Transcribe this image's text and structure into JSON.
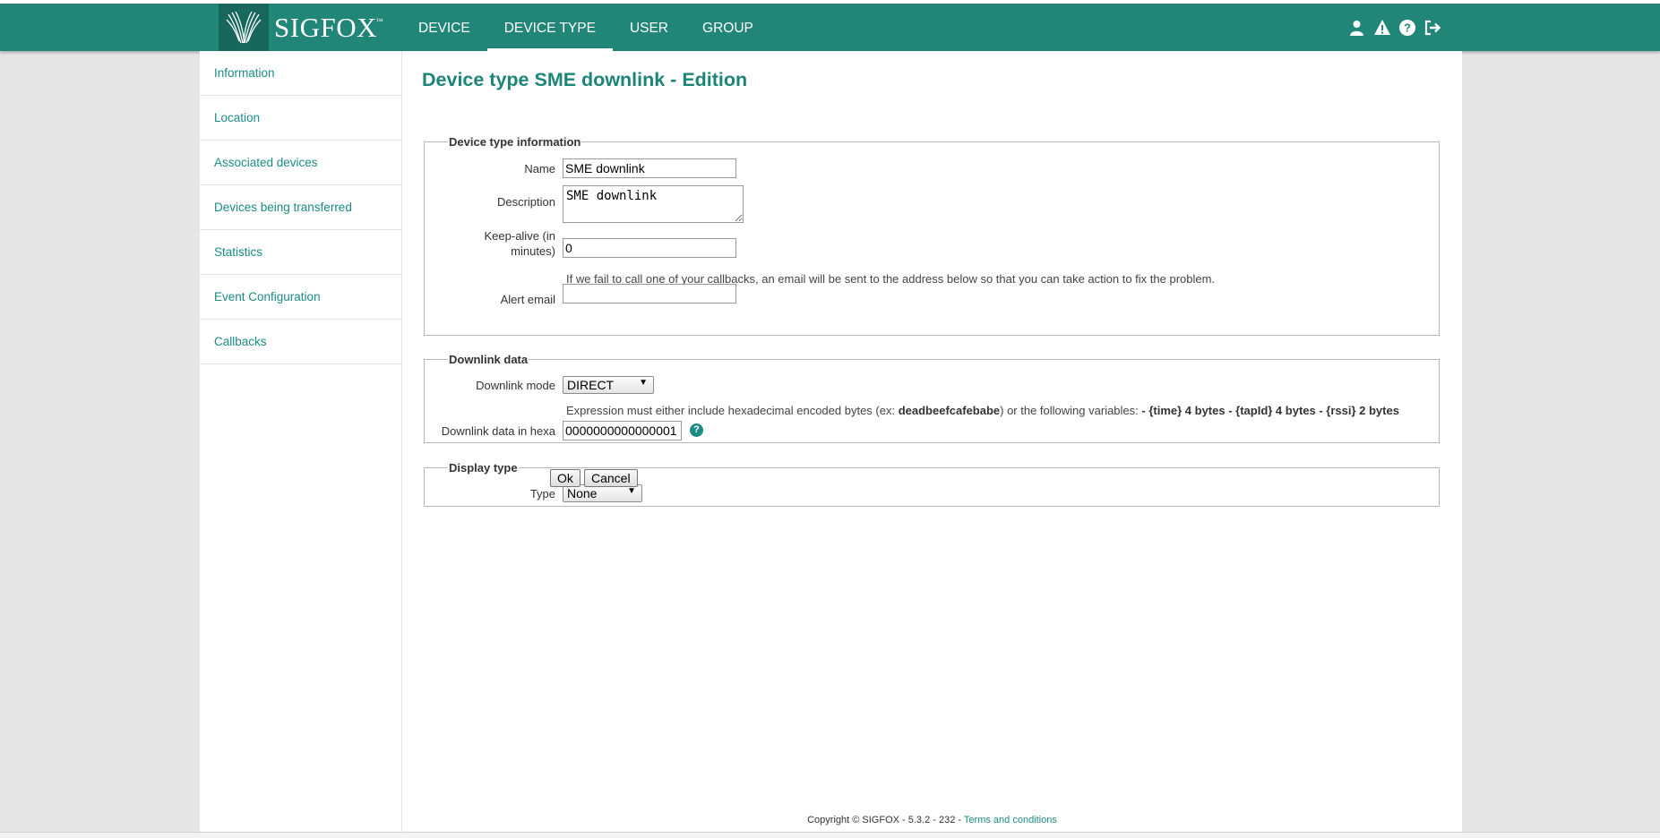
{
  "brand": {
    "name": "SIGFOX",
    "mark": "™"
  },
  "nav": {
    "items": [
      {
        "label": "DEVICE"
      },
      {
        "label": "DEVICE TYPE"
      },
      {
        "label": "USER"
      },
      {
        "label": "GROUP"
      }
    ],
    "active": "DEVICE TYPE"
  },
  "header_icons": [
    "user-icon",
    "warning-icon",
    "help-icon",
    "logout-icon"
  ],
  "sidebar": {
    "items": [
      {
        "label": "Information"
      },
      {
        "label": "Location"
      },
      {
        "label": "Associated devices"
      },
      {
        "label": "Devices being transferred"
      },
      {
        "label": "Statistics"
      },
      {
        "label": "Event Configuration"
      },
      {
        "label": "Callbacks"
      }
    ]
  },
  "page": {
    "title": "Device type SME downlink - Edition"
  },
  "device_type_info": {
    "legend": "Device type information",
    "name_label": "Name",
    "name_value": "SME downlink",
    "description_label": "Description",
    "description_value": "SME downlink",
    "keepalive_label_1": "Keep-alive (in",
    "keepalive_label_2": "minutes)",
    "keepalive_value": "0",
    "alert_hint": "If we fail to call one of your callbacks, an email will be sent to the address below so that you can take action to fix the problem.",
    "alert_email_label": "Alert email",
    "alert_email_value": ""
  },
  "downlink": {
    "legend": "Downlink data",
    "mode_label": "Downlink mode",
    "mode_value": "DIRECT",
    "hint_prefix": "Expression must either include hexadecimal encoded bytes (ex: ",
    "hint_example": "deadbeefcafebabe",
    "hint_middle": ") or the following variables: ",
    "hint_vars": "- {time} 4 bytes - {tapId} 4 bytes - {rssi} 2 bytes",
    "data_label": "Downlink data in hexa",
    "data_value": "0000000000000001"
  },
  "display_type": {
    "legend": "Display type",
    "type_label": "Type",
    "type_value": "None"
  },
  "actions": {
    "ok": "Ok",
    "cancel": "Cancel"
  },
  "footer": {
    "copyright": "Copyright © SIGFOX - 5.3.2 - 232 - ",
    "terms": "Terms and conditions"
  },
  "colors": {
    "header": "#218577",
    "accent": "#1b8b84",
    "title": "#1b8577"
  }
}
